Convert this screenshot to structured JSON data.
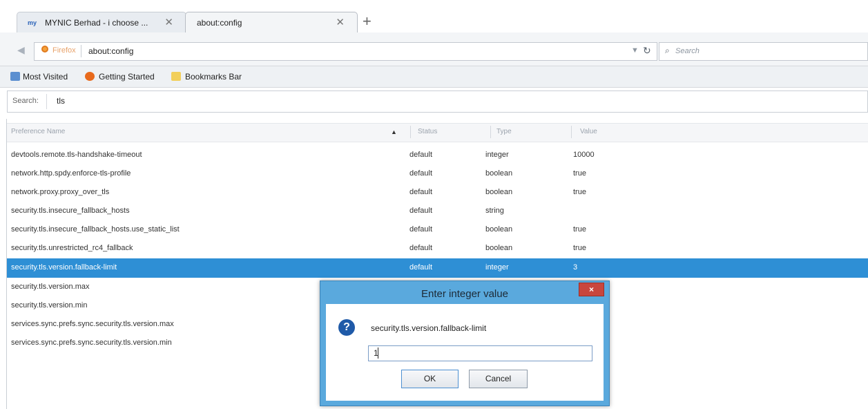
{
  "tabs": [
    {
      "favicon": "my",
      "label": "MYNIC Berhad - i choose ..."
    },
    {
      "label": "about:config"
    }
  ],
  "nav": {
    "brand": "Firefox",
    "url": "about:config",
    "search_placeholder": "Search"
  },
  "bookmarks": [
    {
      "label": "Most Visited",
      "icon": "most-visited-icon"
    },
    {
      "label": "Getting Started",
      "icon": "firefox-icon"
    },
    {
      "label": "Bookmarks Bar",
      "icon": "folder-icon"
    }
  ],
  "config": {
    "search_label": "Search:",
    "search_value": "tls",
    "headers": {
      "name": "Preference Name",
      "status": "Status",
      "type": "Type",
      "value": "Value"
    },
    "rows": [
      {
        "name": "devtools.remote.tls-handshake-timeout",
        "status": "default",
        "type": "integer",
        "value": "10000"
      },
      {
        "name": "network.http.spdy.enforce-tls-profile",
        "status": "default",
        "type": "boolean",
        "value": "true"
      },
      {
        "name": "network.proxy.proxy_over_tls",
        "status": "default",
        "type": "boolean",
        "value": "true"
      },
      {
        "name": "security.tls.insecure_fallback_hosts",
        "status": "default",
        "type": "string",
        "value": ""
      },
      {
        "name": "security.tls.insecure_fallback_hosts.use_static_list",
        "status": "default",
        "type": "boolean",
        "value": "true"
      },
      {
        "name": "security.tls.unrestricted_rc4_fallback",
        "status": "default",
        "type": "boolean",
        "value": "true"
      },
      {
        "name": "security.tls.version.fallback-limit",
        "status": "default",
        "type": "integer",
        "value": "3"
      },
      {
        "name": "security.tls.version.max",
        "status": "",
        "type": "",
        "value": ""
      },
      {
        "name": "security.tls.version.min",
        "status": "",
        "type": "",
        "value": ""
      },
      {
        "name": "services.sync.prefs.sync.security.tls.version.max",
        "status": "",
        "type": "",
        "value": ""
      },
      {
        "name": "services.sync.prefs.sync.security.tls.version.min",
        "status": "",
        "type": "",
        "value": ""
      }
    ]
  },
  "dialog": {
    "title": "Enter integer value",
    "close": "×",
    "message": "security.tls.version.fallback-limit",
    "value": "1",
    "ok": "OK",
    "cancel": "Cancel"
  }
}
